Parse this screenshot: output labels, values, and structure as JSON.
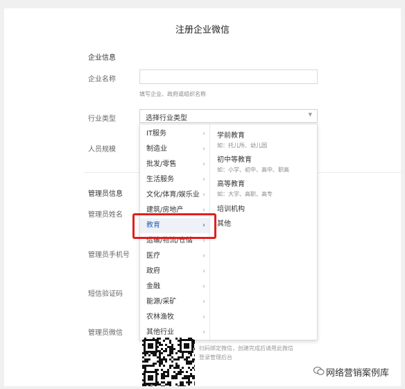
{
  "page": {
    "title": "注册企业微信"
  },
  "sections": {
    "company_info": "企业信息",
    "admin_info": "管理员信息"
  },
  "fields": {
    "company_name": {
      "label": "企业名称",
      "value": "",
      "hint": "填写企业、政府或组织名称"
    },
    "industry": {
      "label": "行业类型",
      "placeholder": "选择行业类型"
    },
    "company_size": {
      "label": "人员规模"
    },
    "admin_name": {
      "label": "管理员姓名"
    },
    "admin_phone": {
      "label": "管理员手机号"
    },
    "sms_code": {
      "label": "短信验证码"
    },
    "admin_wechat": {
      "label": "管理员微信"
    }
  },
  "dropdown": {
    "industries": [
      {
        "label": "IT服务"
      },
      {
        "label": "制造业"
      },
      {
        "label": "批发/零售"
      },
      {
        "label": "生活服务"
      },
      {
        "label": "文化/体育/娱乐业"
      },
      {
        "label": "建筑/房地产"
      },
      {
        "label": "教育"
      },
      {
        "label": "运输/物流/仓储"
      },
      {
        "label": "医疗"
      },
      {
        "label": "政府"
      },
      {
        "label": "金融"
      },
      {
        "label": "能源/采矿"
      },
      {
        "label": "农林渔牧"
      },
      {
        "label": "其他行业"
      }
    ],
    "active_index": 6,
    "subcategories": [
      {
        "label": "学前教育",
        "example": "如：托儿所、幼儿园"
      },
      {
        "label": "初中等教育",
        "example": "如：小学、初中、高中、职高"
      },
      {
        "label": "高等教育",
        "example": "如：大学、高职、高专"
      },
      {
        "label": "培训机构",
        "example": ""
      },
      {
        "label": "其他",
        "example": ""
      }
    ]
  },
  "qr": {
    "caption_line1": "扫码绑定微信，创建完成后请用此微信",
    "caption_line2": "登录管理后台"
  },
  "watermark": {
    "text": "网络营销案例库"
  },
  "colors": {
    "highlight": "#e31d1d",
    "active_text": "#2b64b0"
  }
}
